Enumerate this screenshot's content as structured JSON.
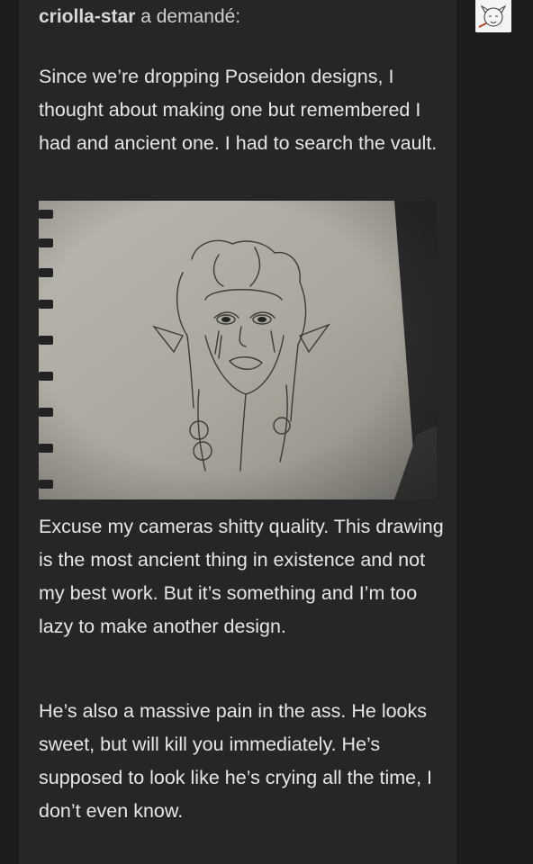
{
  "asker": {
    "name": "criolla-star",
    "suffix": " a demandé:"
  },
  "question": {
    "paragraph_1": "Since we’re dropping Poseidon designs, I thought about making one but remembered I had and ancient one. I had to search the vault.",
    "paragraph_2": "Excuse my cameras shitty quality. This drawing is the most ancient thing in existence and not my best work. But it’s something and I’m too lazy to make another design.",
    "paragraph_3": "He’s also a massive pain in the ass. He looks sweet, but will kill you immediately. He’s supposed to look like he’s crying all the time, I don’t even know."
  },
  "avatar": {
    "icon": "user-avatar-icon"
  },
  "photo": {
    "icon": "sketch-photo-image"
  }
}
